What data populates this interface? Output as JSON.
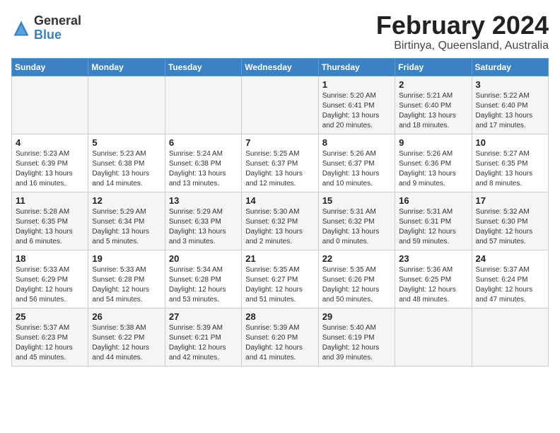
{
  "logo": {
    "general": "General",
    "blue": "Blue"
  },
  "title": "February 2024",
  "subtitle": "Birtinya, Queensland, Australia",
  "weekdays": [
    "Sunday",
    "Monday",
    "Tuesday",
    "Wednesday",
    "Thursday",
    "Friday",
    "Saturday"
  ],
  "weeks": [
    [
      {
        "day": "",
        "info": ""
      },
      {
        "day": "",
        "info": ""
      },
      {
        "day": "",
        "info": ""
      },
      {
        "day": "",
        "info": ""
      },
      {
        "day": "1",
        "info": "Sunrise: 5:20 AM\nSunset: 6:41 PM\nDaylight: 13 hours\nand 20 minutes."
      },
      {
        "day": "2",
        "info": "Sunrise: 5:21 AM\nSunset: 6:40 PM\nDaylight: 13 hours\nand 18 minutes."
      },
      {
        "day": "3",
        "info": "Sunrise: 5:22 AM\nSunset: 6:40 PM\nDaylight: 13 hours\nand 17 minutes."
      }
    ],
    [
      {
        "day": "4",
        "info": "Sunrise: 5:23 AM\nSunset: 6:39 PM\nDaylight: 13 hours\nand 16 minutes."
      },
      {
        "day": "5",
        "info": "Sunrise: 5:23 AM\nSunset: 6:38 PM\nDaylight: 13 hours\nand 14 minutes."
      },
      {
        "day": "6",
        "info": "Sunrise: 5:24 AM\nSunset: 6:38 PM\nDaylight: 13 hours\nand 13 minutes."
      },
      {
        "day": "7",
        "info": "Sunrise: 5:25 AM\nSunset: 6:37 PM\nDaylight: 13 hours\nand 12 minutes."
      },
      {
        "day": "8",
        "info": "Sunrise: 5:26 AM\nSunset: 6:37 PM\nDaylight: 13 hours\nand 10 minutes."
      },
      {
        "day": "9",
        "info": "Sunrise: 5:26 AM\nSunset: 6:36 PM\nDaylight: 13 hours\nand 9 minutes."
      },
      {
        "day": "10",
        "info": "Sunrise: 5:27 AM\nSunset: 6:35 PM\nDaylight: 13 hours\nand 8 minutes."
      }
    ],
    [
      {
        "day": "11",
        "info": "Sunrise: 5:28 AM\nSunset: 6:35 PM\nDaylight: 13 hours\nand 6 minutes."
      },
      {
        "day": "12",
        "info": "Sunrise: 5:29 AM\nSunset: 6:34 PM\nDaylight: 13 hours\nand 5 minutes."
      },
      {
        "day": "13",
        "info": "Sunrise: 5:29 AM\nSunset: 6:33 PM\nDaylight: 13 hours\nand 3 minutes."
      },
      {
        "day": "14",
        "info": "Sunrise: 5:30 AM\nSunset: 6:32 PM\nDaylight: 13 hours\nand 2 minutes."
      },
      {
        "day": "15",
        "info": "Sunrise: 5:31 AM\nSunset: 6:32 PM\nDaylight: 13 hours\nand 0 minutes."
      },
      {
        "day": "16",
        "info": "Sunrise: 5:31 AM\nSunset: 6:31 PM\nDaylight: 12 hours\nand 59 minutes."
      },
      {
        "day": "17",
        "info": "Sunrise: 5:32 AM\nSunset: 6:30 PM\nDaylight: 12 hours\nand 57 minutes."
      }
    ],
    [
      {
        "day": "18",
        "info": "Sunrise: 5:33 AM\nSunset: 6:29 PM\nDaylight: 12 hours\nand 56 minutes."
      },
      {
        "day": "19",
        "info": "Sunrise: 5:33 AM\nSunset: 6:28 PM\nDaylight: 12 hours\nand 54 minutes."
      },
      {
        "day": "20",
        "info": "Sunrise: 5:34 AM\nSunset: 6:28 PM\nDaylight: 12 hours\nand 53 minutes."
      },
      {
        "day": "21",
        "info": "Sunrise: 5:35 AM\nSunset: 6:27 PM\nDaylight: 12 hours\nand 51 minutes."
      },
      {
        "day": "22",
        "info": "Sunrise: 5:35 AM\nSunset: 6:26 PM\nDaylight: 12 hours\nand 50 minutes."
      },
      {
        "day": "23",
        "info": "Sunrise: 5:36 AM\nSunset: 6:25 PM\nDaylight: 12 hours\nand 48 minutes."
      },
      {
        "day": "24",
        "info": "Sunrise: 5:37 AM\nSunset: 6:24 PM\nDaylight: 12 hours\nand 47 minutes."
      }
    ],
    [
      {
        "day": "25",
        "info": "Sunrise: 5:37 AM\nSunset: 6:23 PM\nDaylight: 12 hours\nand 45 minutes."
      },
      {
        "day": "26",
        "info": "Sunrise: 5:38 AM\nSunset: 6:22 PM\nDaylight: 12 hours\nand 44 minutes."
      },
      {
        "day": "27",
        "info": "Sunrise: 5:39 AM\nSunset: 6:21 PM\nDaylight: 12 hours\nand 42 minutes."
      },
      {
        "day": "28",
        "info": "Sunrise: 5:39 AM\nSunset: 6:20 PM\nDaylight: 12 hours\nand 41 minutes."
      },
      {
        "day": "29",
        "info": "Sunrise: 5:40 AM\nSunset: 6:19 PM\nDaylight: 12 hours\nand 39 minutes."
      },
      {
        "day": "",
        "info": ""
      },
      {
        "day": "",
        "info": ""
      }
    ]
  ]
}
